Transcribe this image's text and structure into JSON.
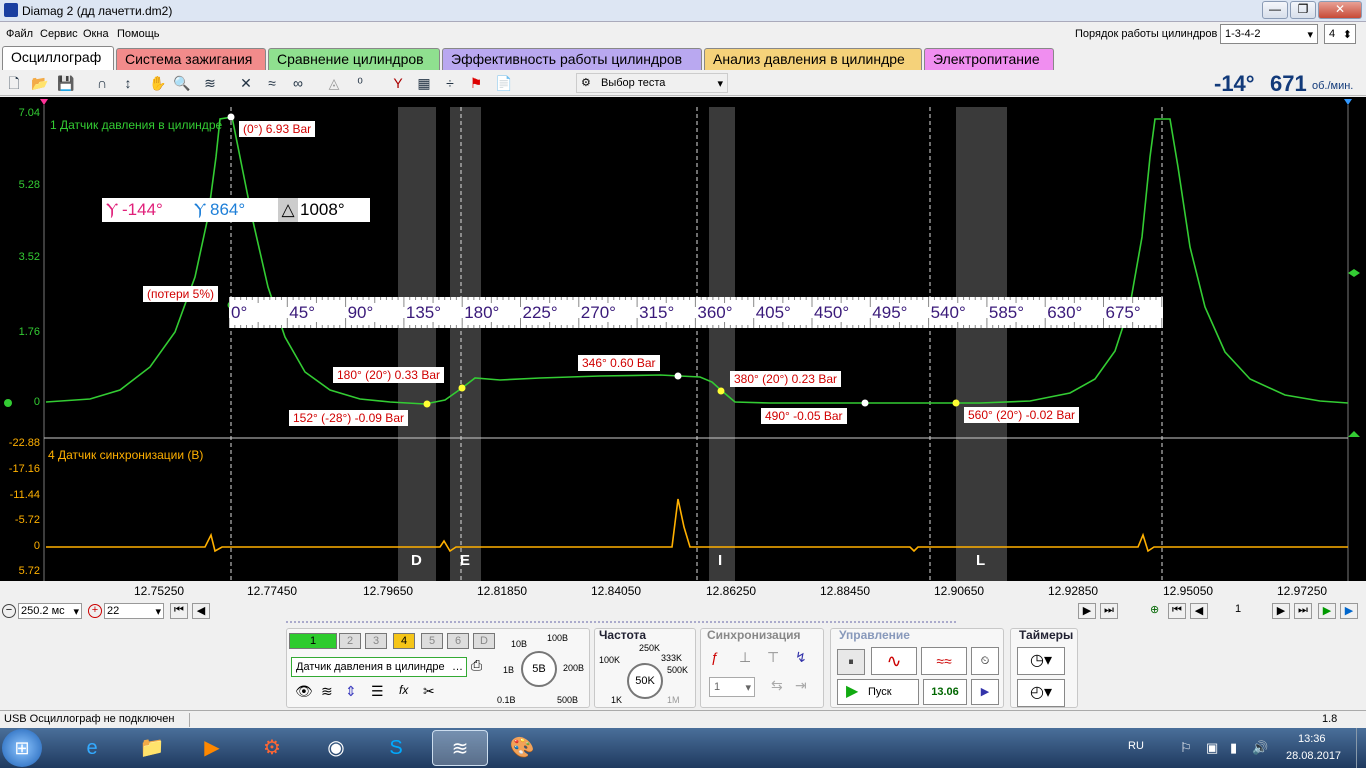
{
  "window": {
    "title": "Diamag 2 (дд лачетти.dm2)",
    "min": "—",
    "max": "❐",
    "close": "✕"
  },
  "menu": [
    "Файл",
    "Сервис",
    "Окна",
    "Помощь"
  ],
  "firing_order": {
    "label": "Порядок работы цилиндров",
    "value": "1-3-4-2",
    "cylinders": "4"
  },
  "tabs": [
    {
      "label": "Осциллограф",
      "color": "#ffffff"
    },
    {
      "label": "Система зажигания",
      "color": "#f28b8b"
    },
    {
      "label": "Сравнение цилиндров",
      "color": "#8fe08f"
    },
    {
      "label": "Эффективность работы цилиндров",
      "color": "#b9a8f0"
    },
    {
      "label": "Анализ давления в цилиндре",
      "color": "#f5d27a"
    },
    {
      "label": "Электропитание",
      "color": "#f08ef0"
    }
  ],
  "toolbar": {
    "test_select": "Выбор теста",
    "angle": "-14°",
    "rpm": "671",
    "rpm_unit": "об./мин."
  },
  "channel1": {
    "name": "1 Датчик давления в цилиндре",
    "color": "#33cc33",
    "yticks": [
      "7.04",
      "5.28",
      "3.52",
      "1.76",
      "0"
    ]
  },
  "channel4": {
    "name": "4 Датчик синхронизации (В)",
    "color": "#ffb000",
    "yticks": [
      "-22.88",
      "-17.16",
      "-11.44",
      "-5.72",
      "0",
      "5.72"
    ]
  },
  "markers": {
    "m1": "-144°",
    "m2": "864°",
    "delta": "1008°"
  },
  "degree_scale": [
    "0°",
    "45°",
    "90°",
    "135°",
    "180°",
    "225°",
    "270°",
    "315°",
    "360°",
    "405°",
    "450°",
    "495°",
    "540°",
    "585°",
    "630°",
    "675°"
  ],
  "annotations": {
    "peak": "(0°) 6.93 Bar",
    "loss": "(потери 5%)",
    "a180": "180° (20°) 0.33 Bar",
    "a152": "152° (-28°) -0.09 Bar",
    "a346": "346° 0.60 Bar",
    "a380": "380° (20°) 0.23 Bar",
    "a490": "490° -0.05 Bar",
    "a560": "560° (20°) -0.02 Bar"
  },
  "zones": [
    "D",
    "E",
    "I",
    "L"
  ],
  "xaxis": [
    "12.75250",
    "12.77450",
    "12.79650",
    "12.81850",
    "12.84050",
    "12.86250",
    "12.88450",
    "12.90650",
    "12.92850",
    "12.95050",
    "12.97250"
  ],
  "bottom": {
    "timebase": "250.2 мс",
    "trigger": "22",
    "page": "1"
  },
  "channels_sel": [
    "1",
    "2",
    "3",
    "4",
    "5",
    "6",
    "D"
  ],
  "sensor": "Датчик давления в цилиндре",
  "volt": {
    "value": "5В",
    "marks": [
      "10В",
      "100В",
      "200В",
      "500В",
      "1В",
      "0.1В"
    ]
  },
  "freq": {
    "title": "Частота",
    "value": "50K",
    "marks": [
      "250K",
      "333K",
      "500K",
      "100K",
      "1K",
      "1M"
    ]
  },
  "sync": {
    "title": "Синхронизация",
    "channel": "1"
  },
  "control": {
    "title": "Управление",
    "start": "Пуск",
    "value": "13.06"
  },
  "timers": {
    "title": "Таймеры"
  },
  "status": {
    "left": "USB Осциллограф не подключен",
    "right": "1.8"
  },
  "taskbar": {
    "lang": "RU",
    "time": "13:36",
    "date": "28.08.2017"
  }
}
